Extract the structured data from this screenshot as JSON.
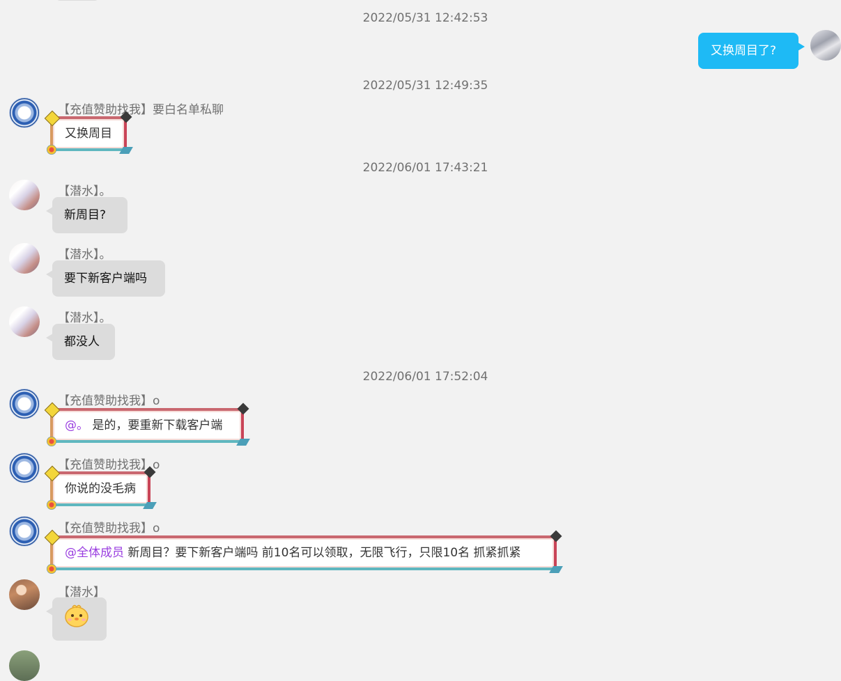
{
  "timestamps": {
    "t1": "2022/05/31 12:42:53",
    "t2": "2022/05/31 12:49:35",
    "t3": "2022/06/01 17:43:21",
    "t4": "2022/06/01 17:52:04"
  },
  "messages": [
    {
      "sender": "",
      "text": "又换周目了?",
      "avatar": "self-avatar"
    },
    {
      "sender": "【充值赞助找我】要白名单私聊",
      "text": "又换周目",
      "avatar": "sponsor-avatar"
    },
    {
      "sender": "【潜水】。",
      "text": "新周目?",
      "avatar": "diver-avatar"
    },
    {
      "sender": "【潜水】。",
      "text": "要下新客户端吗",
      "avatar": "diver-avatar"
    },
    {
      "sender": "【潜水】。",
      "text": "都没人",
      "avatar": "diver-avatar"
    },
    {
      "sender": "【充值赞助找我】o",
      "mention": "@。",
      "text": " 是的，要重新下载客户端",
      "avatar": "sponsor-avatar"
    },
    {
      "sender": "【充值赞助找我】o",
      "text": "你说的没毛病",
      "avatar": "sponsor-avatar"
    },
    {
      "sender": "【充值赞助找我】o",
      "mention": "@全体成员",
      "text": " 新周目？要下新客户端吗 前10名可以领取，无限飞行，只限10名 抓紧抓紧",
      "avatar": "sponsor-avatar"
    },
    {
      "sender": "【潜水】",
      "sticker": "chick-emoji",
      "avatar": "diver-avatar-2"
    }
  ],
  "colors": {
    "self_bubble": "#1ebaf5",
    "other_bubble": "#dcdcdc",
    "mention": "#9a3ee0",
    "background": "#f2f2f2"
  }
}
